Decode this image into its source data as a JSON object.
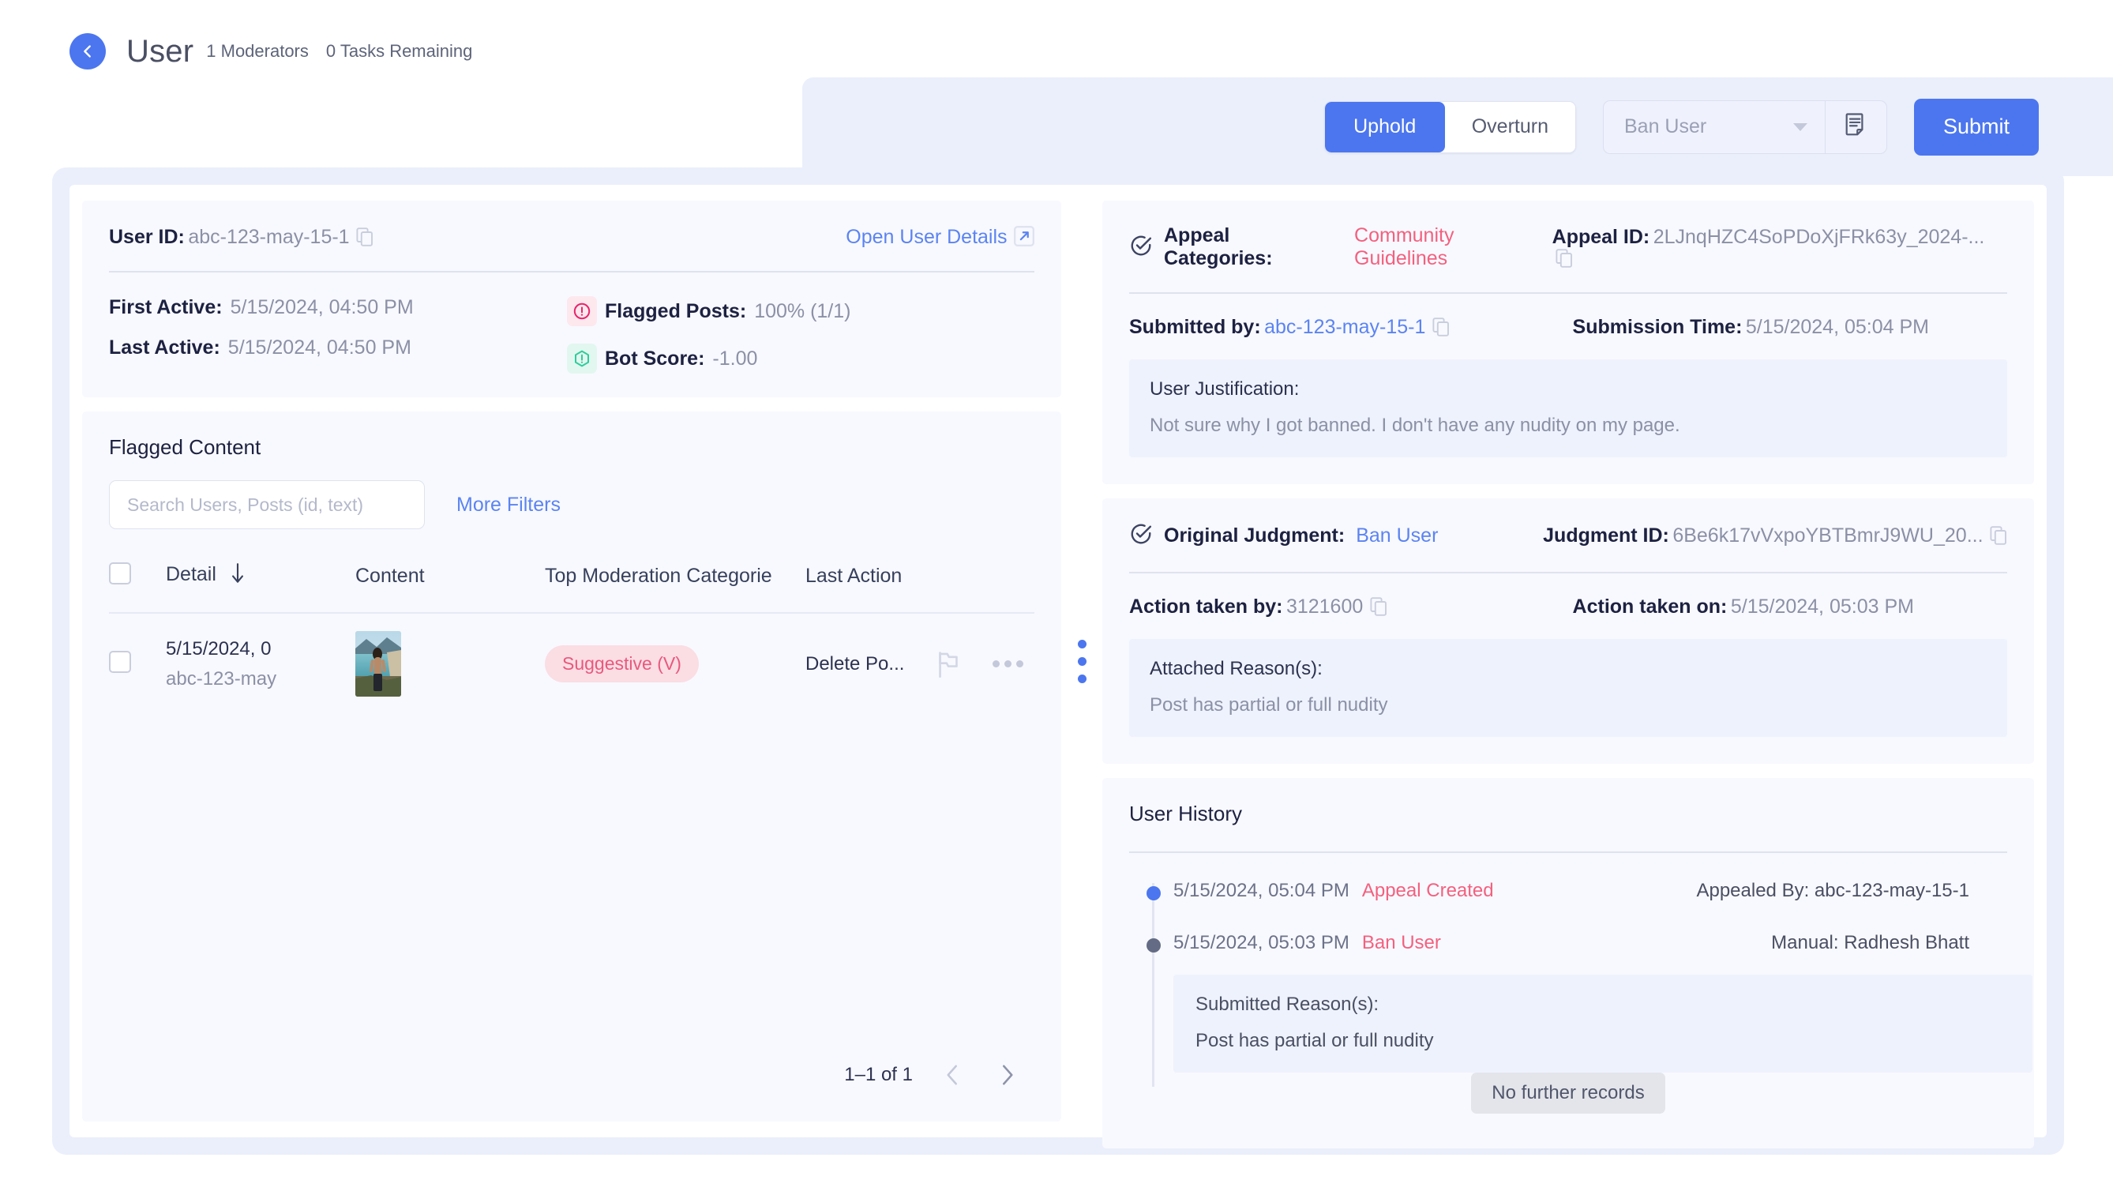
{
  "header": {
    "back_icon": "chevron-left-icon",
    "title": "User",
    "moderators": "1 Moderators",
    "tasks_remaining": "0 Tasks Remaining"
  },
  "action_bar": {
    "uphold_label": "Uphold",
    "overturn_label": "Overturn",
    "action_select_value": "Ban User",
    "note_icon": "note-icon",
    "submit_label": "Submit",
    "accent_color": "#4c76ef"
  },
  "user_info": {
    "user_id_label": "User ID:",
    "user_id_value": "abc-123-may-15-1",
    "open_user_details": "Open User Details",
    "first_active_label": "First Active:",
    "first_active_value": "5/15/2024, 04:50 PM",
    "last_active_label": "Last Active:",
    "last_active_value": "5/15/2024, 04:50 PM",
    "flagged_posts_label": "Flagged Posts:",
    "flagged_posts_value": "100% (1/1)",
    "bot_score_label": "Bot Score:",
    "bot_score_value": "-1.00"
  },
  "flagged_content": {
    "title": "Flagged Content",
    "search_placeholder": "Search Users, Posts (id, text)",
    "search_value": "",
    "more_filters": "More Filters",
    "columns": {
      "detail": "Detail",
      "content": "Content",
      "top_moderation": "Top Moderation Categorie",
      "last_action": "Last Action"
    },
    "rows": [
      {
        "detail_date": "5/15/2024, 0",
        "detail_user": "abc-123-may",
        "category": "Suggestive (V)",
        "last_action": "Delete Po..."
      }
    ],
    "pagination": "1–1 of 1"
  },
  "appeal": {
    "categories_label": "Appeal Categories:",
    "categories_value": "Community Guidelines",
    "appeal_id_label": "Appeal ID:",
    "appeal_id_value": "2LJnqHZC4SoPDoXjFRk63y_2024-...",
    "submitted_by_label": "Submitted by:",
    "submitted_by_value": "abc-123-may-15-1",
    "submission_time_label": "Submission Time:",
    "submission_time_value": "5/15/2024, 05:04 PM",
    "justification_label": "User Justification:",
    "justification_text": "Not sure why I got banned. I don't have any nudity on my page."
  },
  "judgment": {
    "original_label": "Original Judgment:",
    "original_value": "Ban User",
    "judgment_id_label": "Judgment ID:",
    "judgment_id_value": "6Be6k17vVxpoYBTBmrJ9WU_20...",
    "taken_by_label": "Action taken by:",
    "taken_by_value": "3121600",
    "taken_on_label": "Action taken on:",
    "taken_on_value": "5/15/2024, 05:03 PM",
    "reasons_label": "Attached Reason(s):",
    "reasons_text": "Post has partial or full nudity"
  },
  "history": {
    "title": "User History",
    "events": [
      {
        "time": "5/15/2024, 05:04 PM",
        "event": "Appeal Created",
        "meta": "Appealed By: abc-123-may-15-1"
      },
      {
        "time": "5/15/2024, 05:03 PM",
        "event": "Ban User",
        "meta": "Manual: Radhesh Bhatt"
      }
    ],
    "submitted_reason_label": "Submitted Reason(s):",
    "submitted_reason_text": "Post has partial or full nudity",
    "no_further_records": "No further records"
  }
}
